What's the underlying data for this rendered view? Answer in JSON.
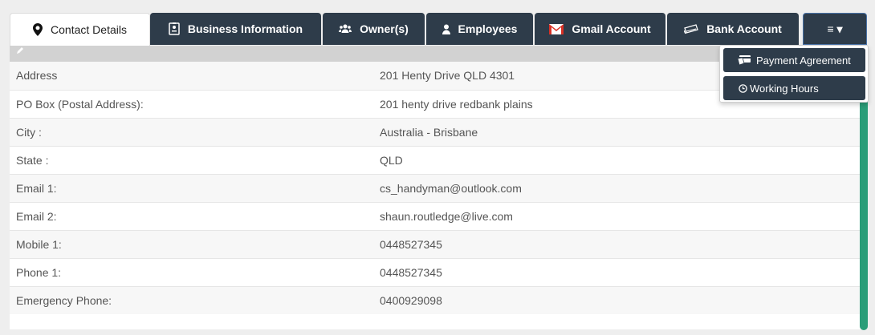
{
  "tabs": [
    {
      "label": "Contact Details",
      "icon": "map-marker-icon",
      "active": true
    },
    {
      "label": "Business Information",
      "icon": "id-badge-icon"
    },
    {
      "label": "Owner(s)",
      "icon": "users-icon"
    },
    {
      "label": "Employees",
      "icon": "user-icon"
    },
    {
      "label": "Gmail Account",
      "icon": "gmail-icon"
    },
    {
      "label": "Bank Account",
      "icon": "money-icon"
    },
    {
      "label": "≡ ▾",
      "icon": "hamburger-icon"
    }
  ],
  "menu": {
    "items": [
      {
        "label": "Payment Agreement",
        "icon": "credit-card-icon"
      },
      {
        "label": "Working Hours",
        "icon": "clock-icon"
      }
    ]
  },
  "details": [
    {
      "label": "Address",
      "value": "201 Henty Drive QLD 4301"
    },
    {
      "label": "PO Box (Postal Address):",
      "value": "201 henty drive redbank plains"
    },
    {
      "label": "City :",
      "value": "Australia - Brisbane"
    },
    {
      "label": "State :",
      "value": "QLD"
    },
    {
      "label": "Email 1:",
      "value": "cs_handyman@outlook.com"
    },
    {
      "label": "Email 2:",
      "value": "shaun.routledge@live.com"
    },
    {
      "label": "Mobile 1:",
      "value": "0448527345"
    },
    {
      "label": "Phone 1:",
      "value": "0448527345"
    },
    {
      "label": "Emergency Phone:",
      "value": "0400929098"
    }
  ],
  "colors": {
    "tab_bg": "#2e3c4a",
    "scrollbar": "#2a9d78",
    "gmail_red": "#d93025"
  }
}
